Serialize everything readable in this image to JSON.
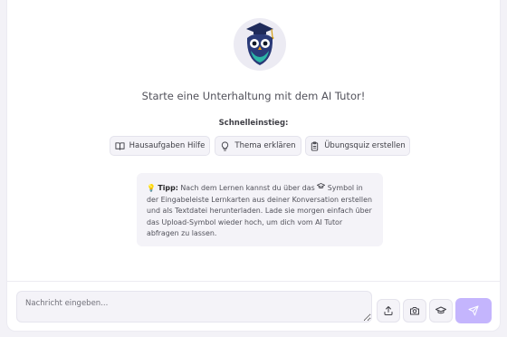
{
  "welcome": {
    "headline": "Starte eine Unterhaltung mit dem AI Tutor!",
    "avatar_icon": "owl-graduation-cap-icon"
  },
  "quick_start": {
    "label": "Schnelleinstieg:",
    "chips": [
      {
        "label": "Hausaufgaben Hilfe",
        "icon": "book-icon"
      },
      {
        "label": "Thema erklären",
        "icon": "lightbulb-icon"
      },
      {
        "label": "Übungsquiz erstellen",
        "icon": "clipboard-icon"
      }
    ]
  },
  "tip": {
    "emoji": "💡",
    "title": "Tipp:",
    "text_before": " Nach dem Lernen kannst du über das ",
    "icon": "graduation-cap-icon",
    "text_after": " Symbol in der Eingabeleiste Lernkarten aus deiner Konversation erstellen und als Textdatei herunterladen. Lade sie morgen einfach über das Upload-Symbol wieder hoch, um dich vom AI Tutor abfragen zu lassen."
  },
  "composer": {
    "placeholder": "Nachricht eingeben...",
    "buttons": [
      "upload-icon",
      "camera-icon",
      "graduation-cap-icon",
      "send-icon"
    ]
  },
  "colors": {
    "send_button": "#c4b5fd",
    "chip_bg": "#f4f3f8",
    "owl_navy": "#1e2a5a",
    "owl_teal": "#2bb5a6"
  }
}
